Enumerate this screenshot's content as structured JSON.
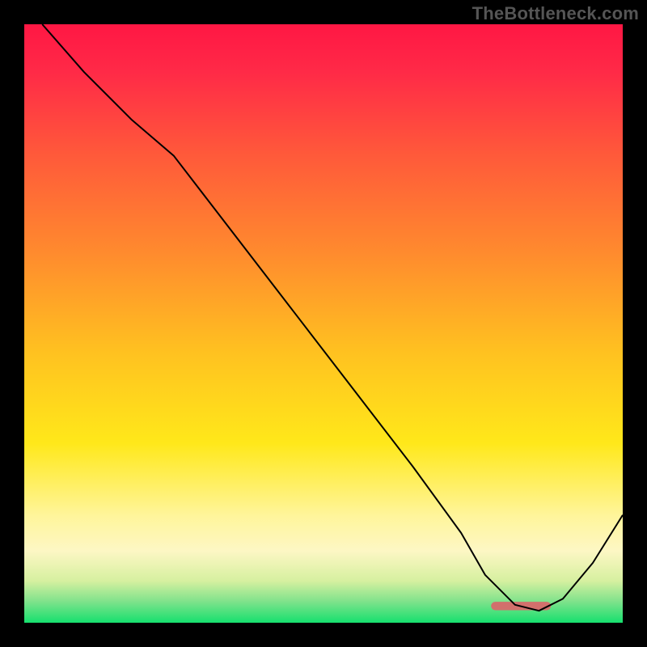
{
  "watermark": "TheBottleneck.com",
  "chart_data": {
    "type": "line",
    "title": "",
    "xlabel": "",
    "ylabel": "",
    "xlim": [
      0,
      100
    ],
    "ylim": [
      0,
      100
    ],
    "background_gradient": [
      {
        "pos": 0.0,
        "color": "#ff1744"
      },
      {
        "pos": 0.08,
        "color": "#ff2a47"
      },
      {
        "pos": 0.22,
        "color": "#ff5a3a"
      },
      {
        "pos": 0.38,
        "color": "#ff8a2e"
      },
      {
        "pos": 0.55,
        "color": "#ffc220"
      },
      {
        "pos": 0.7,
        "color": "#ffe81a"
      },
      {
        "pos": 0.82,
        "color": "#fff59a"
      },
      {
        "pos": 0.88,
        "color": "#fdf7c4"
      },
      {
        "pos": 0.93,
        "color": "#d6f0a0"
      },
      {
        "pos": 0.965,
        "color": "#7ee28b"
      },
      {
        "pos": 1.0,
        "color": "#16e06e"
      }
    ],
    "series": [
      {
        "name": "curve",
        "color": "#000000",
        "width": 2,
        "x": [
          3,
          10,
          18,
          25,
          35,
          45,
          55,
          65,
          73,
          77,
          82,
          86,
          90,
          95,
          100
        ],
        "y": [
          100,
          92,
          84,
          78,
          65,
          52,
          39,
          26,
          15,
          8,
          3,
          2,
          4,
          10,
          18
        ]
      }
    ],
    "marker": {
      "name": "minimum-marker",
      "color": "#d2706c",
      "x_start": 78,
      "x_end": 88,
      "y": 2.8,
      "thickness_pct": 1.4
    }
  }
}
